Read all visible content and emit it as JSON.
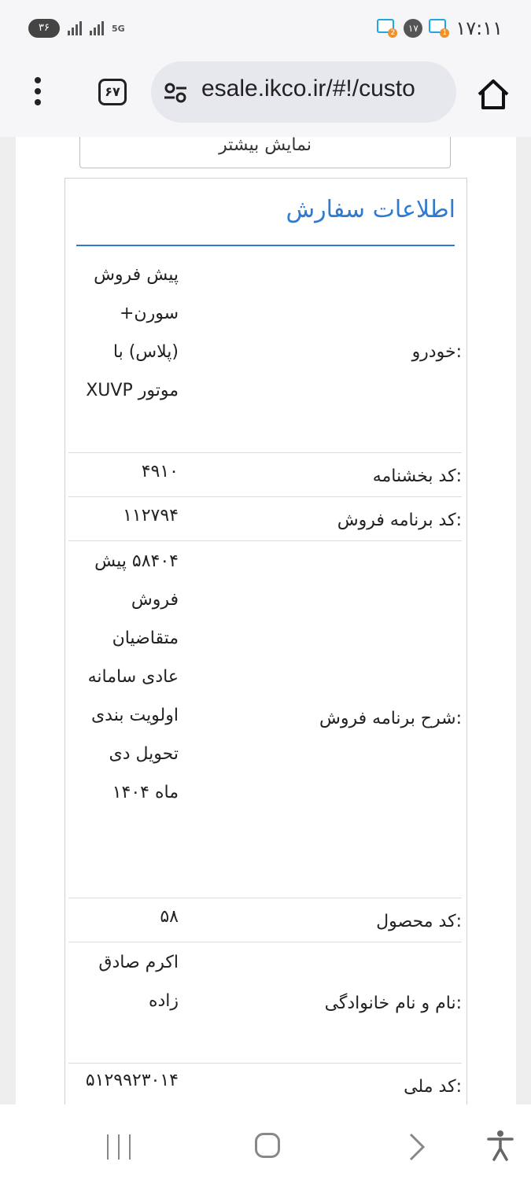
{
  "status_bar": {
    "time": "۱۷:۱۱",
    "notification_count": "۱۷",
    "notif_badge_1": "1",
    "notif_badge_2": "2",
    "battery": "۳۶",
    "network": "5G"
  },
  "browser": {
    "url": "esale.ikco.ir/#!/custo",
    "tab_count": "۶۷"
  },
  "page": {
    "more_button": "نمایش بیشتر",
    "section_title": "اطلاعات سفارش",
    "fields": [
      {
        "label": "خودرو:",
        "value": "پیش فروش سورن+ (پلاس) با موتور XUVP"
      },
      {
        "label": "کد بخشنامه:",
        "value": "۴۹۱۰"
      },
      {
        "label": "کد برنامه فروش:",
        "value": "۱۱۲۷۹۴"
      },
      {
        "label": "شرح برنامه فروش:",
        "value": "۵۸۴۰۴ پیش فروش متقاضیان عادی سامانه اولویت بندی تحویل دی ماه ۱۴۰۴"
      },
      {
        "label": "کد محصول:",
        "value": "۵۸"
      },
      {
        "label": "نام و نام خانوادگی:",
        "value": "اکرم صادق زاده"
      },
      {
        "label": "کد ملی:",
        "value": "۵۱۲۹۹۲۳۰۱۴"
      }
    ]
  }
}
